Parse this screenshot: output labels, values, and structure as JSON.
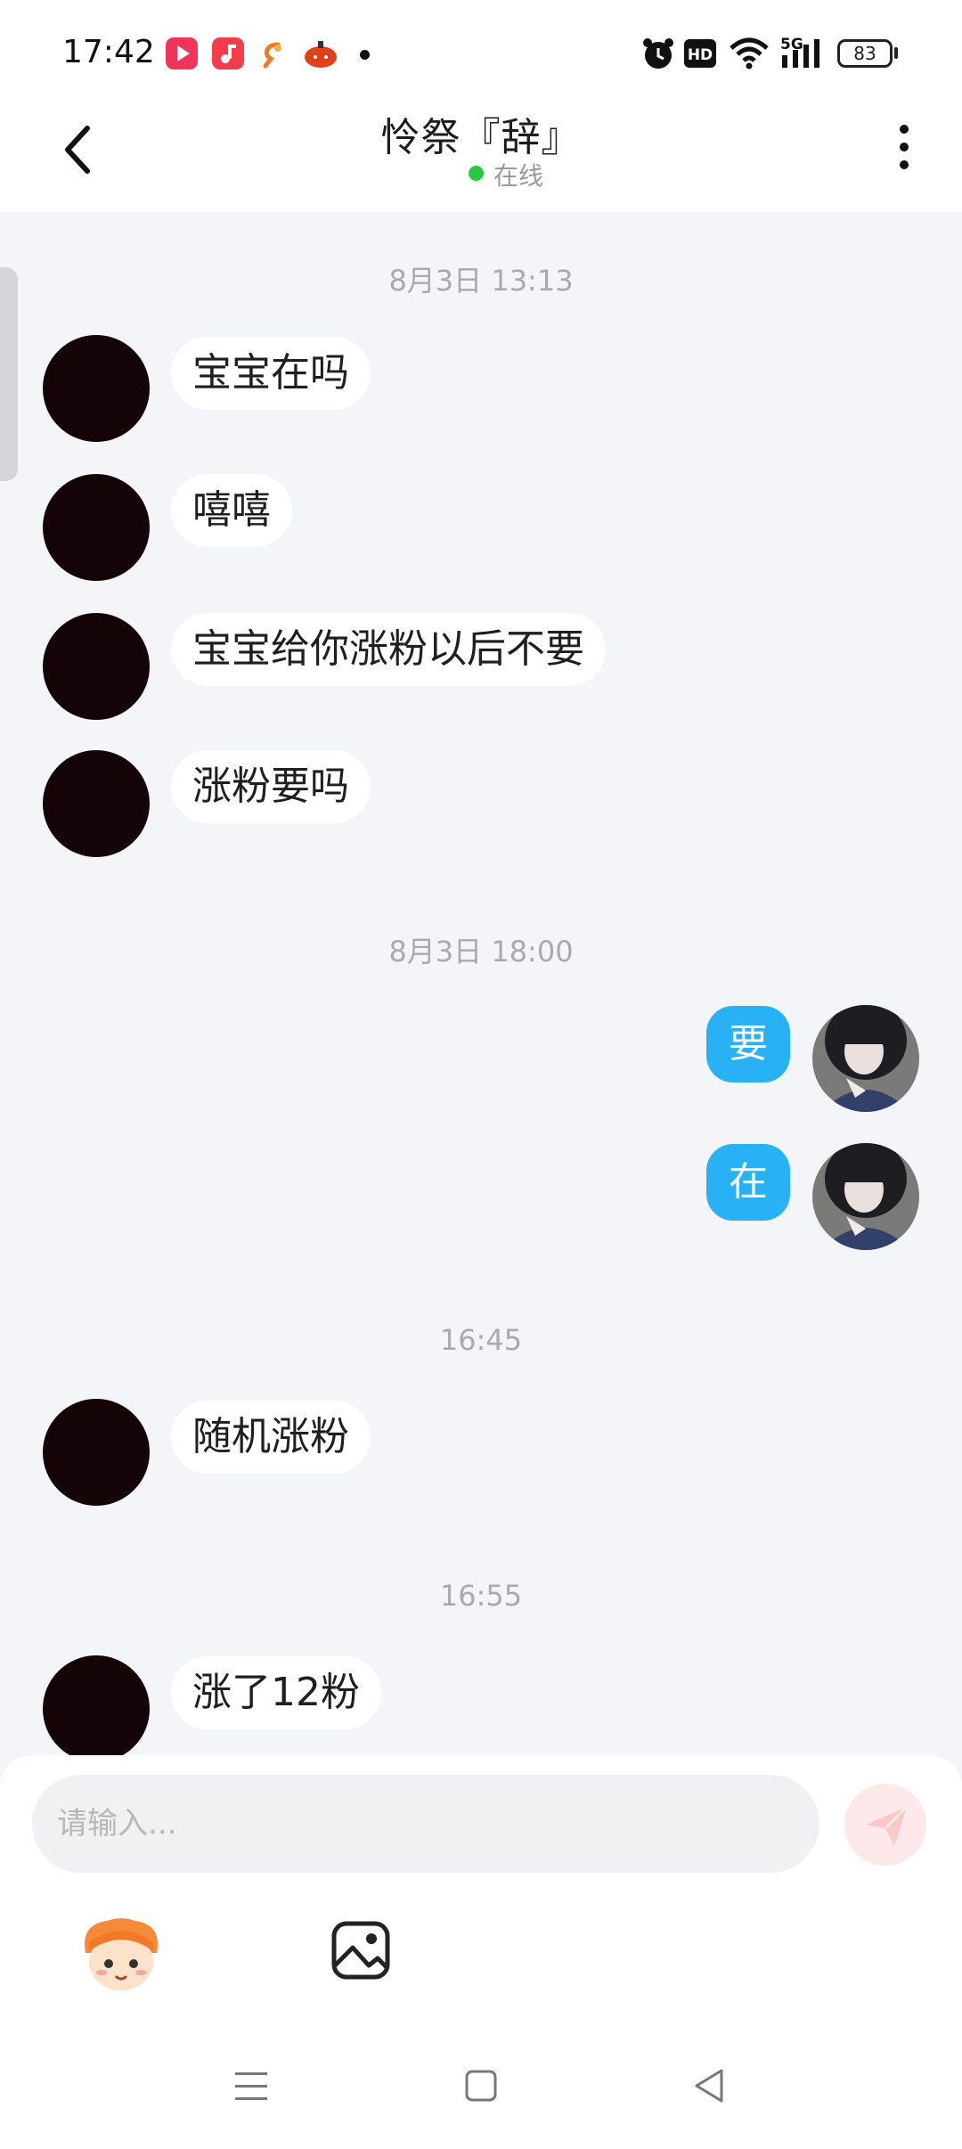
{
  "status_bar": {
    "time": "17:42",
    "battery": "83",
    "network": "5G",
    "icons": [
      "video-app-icon",
      "music-app-icon",
      "shrimp-app-icon",
      "pumpkin-app-icon",
      "more-dot",
      "alarm-icon",
      "hd-icon",
      "wifi-icon",
      "signal-icon",
      "battery-icon"
    ]
  },
  "header": {
    "title": "怜祭『辞』",
    "status": "在线",
    "status_color": "#27c93f"
  },
  "messages": [
    {
      "type": "timestamp",
      "text": "8月3日 13:13"
    },
    {
      "type": "incoming",
      "text": "宝宝在吗"
    },
    {
      "type": "incoming",
      "text": "嘻嘻"
    },
    {
      "type": "incoming",
      "text": "宝宝给你涨粉以后不要"
    },
    {
      "type": "incoming",
      "text": "涨粉要吗"
    },
    {
      "type": "timestamp",
      "text": "8月3日 18:00"
    },
    {
      "type": "outgoing",
      "text": "要"
    },
    {
      "type": "outgoing",
      "text": "在"
    },
    {
      "type": "timestamp",
      "text": "16:45"
    },
    {
      "type": "incoming",
      "text": "随机涨粉"
    },
    {
      "type": "timestamp",
      "text": "16:55"
    },
    {
      "type": "incoming",
      "text": "涨了12粉"
    }
  ],
  "input": {
    "placeholder": "请输入..."
  },
  "colors": {
    "outgoing_bubble": "#29b1f5",
    "chat_background": "#f3f5f8",
    "send_button": "#fde9e9"
  }
}
